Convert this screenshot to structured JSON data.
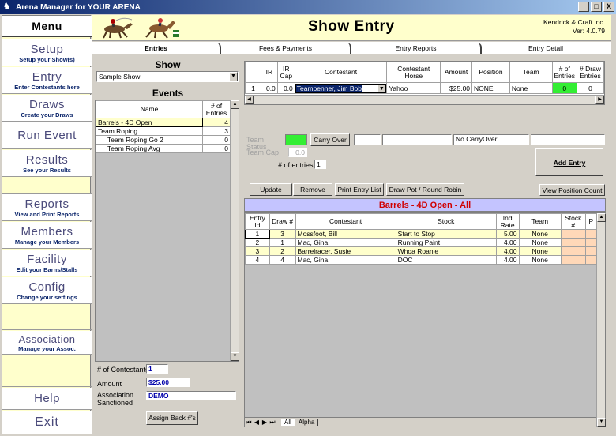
{
  "window": {
    "title": "Arena Manager for YOUR ARENA",
    "controls": [
      "_",
      "□",
      "X"
    ]
  },
  "menu": {
    "title": "Menu",
    "items": [
      {
        "label": "Setup",
        "sub": "Setup your Show(s)"
      },
      {
        "label": "Entry",
        "sub": "Enter Contestants here"
      },
      {
        "label": "Draws",
        "sub": "Create your Draws"
      },
      {
        "label": "Run Event",
        "sub": ""
      },
      {
        "label": "Results",
        "sub": "See your Results"
      },
      {
        "label": "Reports",
        "sub": "View and Print Reports"
      },
      {
        "label": "Members",
        "sub": "Manage your Members"
      },
      {
        "label": "Facility",
        "sub": "Edit your Barns/Stalls"
      },
      {
        "label": "Config",
        "sub": "Change your settings"
      },
      {
        "label": "Association",
        "sub": "Manage your Assoc."
      },
      {
        "label": "Help",
        "sub": ""
      },
      {
        "label": "Exit",
        "sub": ""
      }
    ]
  },
  "header": {
    "title": "Show Entry",
    "company": "Kendrick & Craft Inc.",
    "version": "Ver: 4.0.79"
  },
  "tabs": [
    "Entries",
    "Fees & Payments",
    "Entry Reports",
    "Entry Detail"
  ],
  "show": {
    "heading": "Show",
    "selected": "Sample Show"
  },
  "events": {
    "heading": "Events",
    "columns": [
      "Name",
      "# of Entries"
    ],
    "rows": [
      {
        "name": "Barrels - 4D Open",
        "entries": "4"
      },
      {
        "name": "Team Roping",
        "entries": "3"
      },
      {
        "name": "Team Roping Go 2",
        "entries": "0"
      },
      {
        "name": "Team Roping Avg",
        "entries": "0"
      }
    ]
  },
  "summary": {
    "contestants_label": "# of Contestants",
    "contestants": "1",
    "amount_label": "Amount",
    "amount": "$25.00",
    "assoc_label": "Association Sanctioned",
    "assoc": "DEMO",
    "assign_button": "Assign Back #'s"
  },
  "entry_grid": {
    "columns": [
      "",
      "IR",
      "IR Cap",
      "Contestant",
      "Contestant Horse",
      "Amount",
      "Position",
      "Team",
      "# of Entries",
      "# Draw Entries"
    ],
    "row": {
      "num": "1",
      "ir": "0.0",
      "ircap": "0.0",
      "contestant": "Teampenner, Jim Bob",
      "horse": "Yahoo",
      "amount": "$25.00",
      "position": "NONE",
      "team": "None",
      "entries": "0",
      "draw": "0"
    }
  },
  "team": {
    "team_label": "Team",
    "status_label": "Status",
    "cap_label": "Team Cap",
    "cap_value": "0.0",
    "carry_button": "Carry Over",
    "carry_status": "No CarryOver",
    "entries_label": "# of entries",
    "entries_value": "1",
    "add_button": "Add Entry"
  },
  "actions": [
    "Update",
    "Remove",
    "Print Entry List",
    "Draw Pot / Round Robin"
  ],
  "view_position": "View Position Count",
  "draw_banner": "Barrels - 4D Open - All",
  "draw_grid": {
    "columns": [
      "Entry Id",
      "Draw #",
      "Contestant",
      "Stock",
      "Ind Rate",
      "Team",
      "Stock #",
      "P"
    ],
    "rows": [
      {
        "id": "1",
        "draw": "3",
        "contestant": "Mossfoot, Bill",
        "stock": "Start to Stop",
        "rate": "5.00",
        "team": "None"
      },
      {
        "id": "2",
        "draw": "1",
        "contestant": "Mac, Gina",
        "stock": "Running Paint",
        "rate": "4.00",
        "team": "None"
      },
      {
        "id": "3",
        "draw": "2",
        "contestant": "Barrelracer, Susie",
        "stock": "Whoa Roanie",
        "rate": "4.00",
        "team": "None"
      },
      {
        "id": "4",
        "draw": "4",
        "contestant": "Mac, Gina",
        "stock": "DOC",
        "rate": "4.00",
        "team": "None"
      }
    ]
  },
  "bottom_tabs": [
    "All",
    "Alpha"
  ],
  "colors": {
    "menu_bg": "#ffffcc",
    "green": "#33ee33",
    "highlight": "#ffffcc",
    "banner": "#c4c4ff",
    "stock": "#ffd8b8"
  }
}
